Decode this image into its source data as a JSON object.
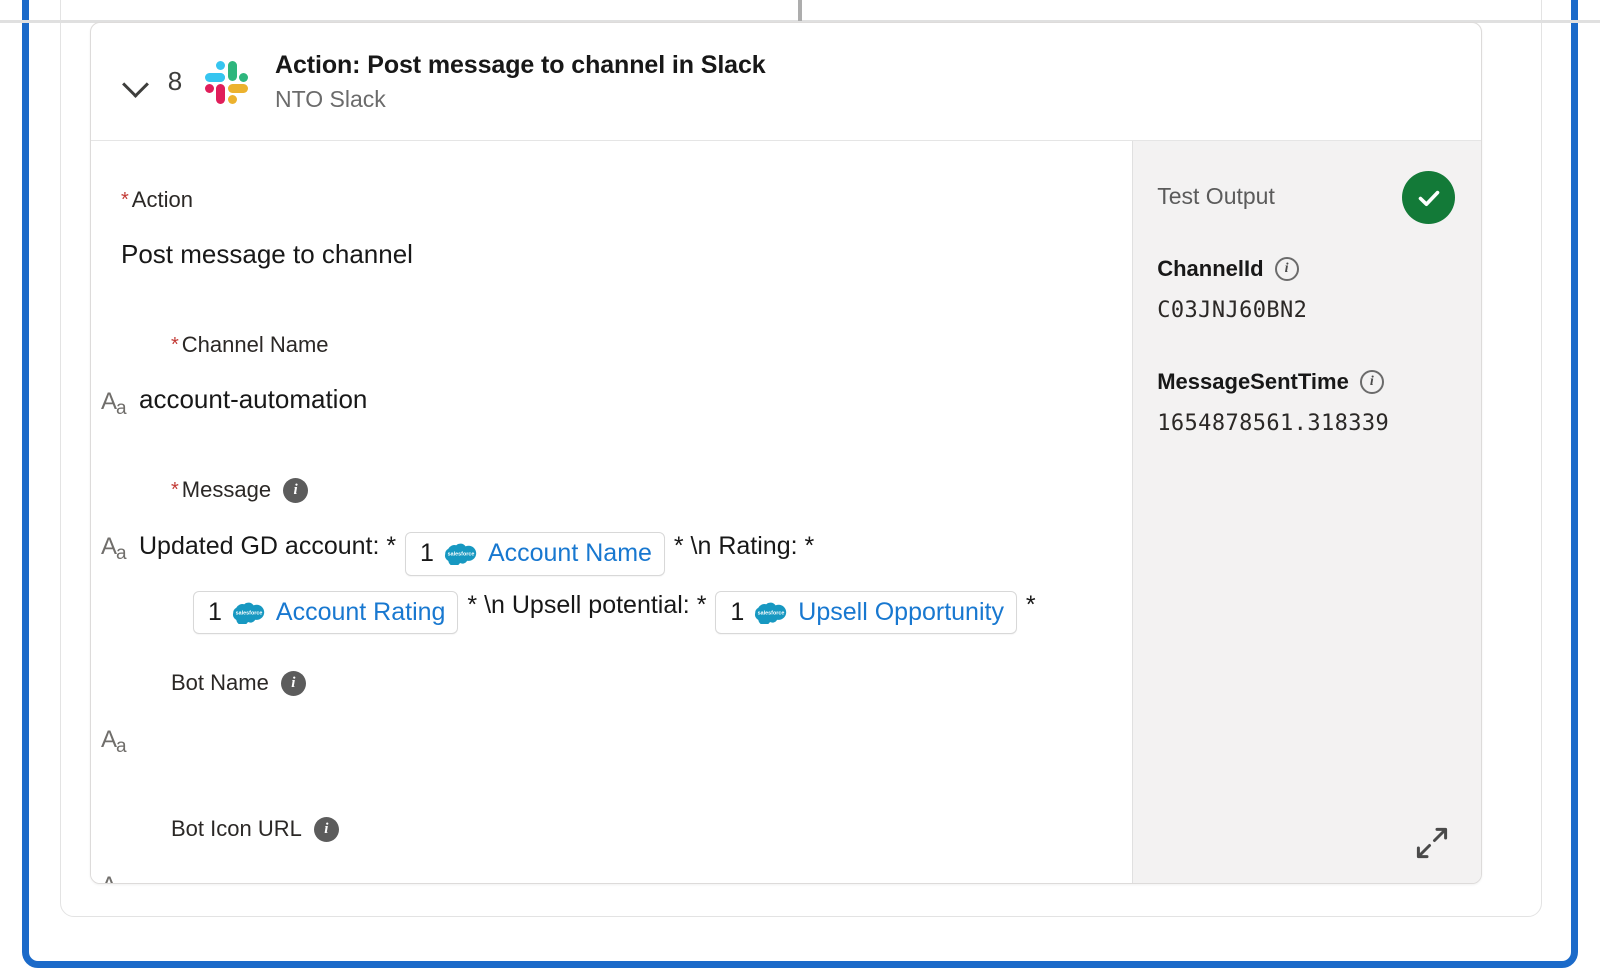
{
  "connector": {
    "icon": "flow-connector-line"
  },
  "action_card": {
    "header": {
      "collapse_icon": "chevron-down-icon",
      "step_number": "8",
      "app_icon": "slack-logo-icon",
      "title": "Action: Post message to channel in Slack",
      "subtitle": "NTO Slack"
    },
    "fields": {
      "action": {
        "required_mark": "*",
        "label": "Action",
        "value": "Post message to channel",
        "type_icon": "text-type-icon"
      },
      "channel_name": {
        "required_mark": "*",
        "label": "Channel Name",
        "value": "account-automation",
        "type_icon": "text-type-icon"
      },
      "message": {
        "required_mark": "*",
        "label": "Message",
        "info_icon": "info-icon",
        "type_icon": "text-type-icon",
        "parts": [
          {
            "kind": "text",
            "text": "Updated GD account: *"
          },
          {
            "kind": "pill",
            "num": "1",
            "icon": "salesforce-cloud-icon",
            "label": "Account Name"
          },
          {
            "kind": "text",
            "text": "* \\n Rating: *"
          }
        ],
        "parts_line2": [
          {
            "kind": "pill",
            "num": "1",
            "icon": "salesforce-cloud-icon",
            "label": "Account Rating"
          },
          {
            "kind": "text",
            "text": "* \\n Upsell potential: *"
          },
          {
            "kind": "pill",
            "num": "1",
            "icon": "salesforce-cloud-icon",
            "label": "Upsell Opportunity"
          },
          {
            "kind": "text",
            "text": "*"
          }
        ]
      },
      "bot_name": {
        "label": "Bot Name",
        "info_icon": "info-icon",
        "value": "",
        "type_icon": "text-type-icon"
      },
      "bot_icon_url": {
        "label": "Bot Icon URL",
        "info_icon": "info-icon",
        "value": "",
        "type_icon": "text-type-icon"
      }
    },
    "test_output": {
      "title": "Test Output",
      "status_icon": "success-check-icon",
      "status_color": "#137a38",
      "entries": [
        {
          "key": "ChannelId",
          "info_icon": "info-icon",
          "value": "C03JNJ60BN2"
        },
        {
          "key": "MessageSentTime",
          "info_icon": "info-icon",
          "value": "1654878561.318339"
        }
      ],
      "expand_icon": "expand-diagonal-icon"
    }
  },
  "colors": {
    "focus_border": "#1b6ac9",
    "required": "#c23934",
    "link": "#1878d0",
    "panel_bg": "#f3f2f2"
  }
}
